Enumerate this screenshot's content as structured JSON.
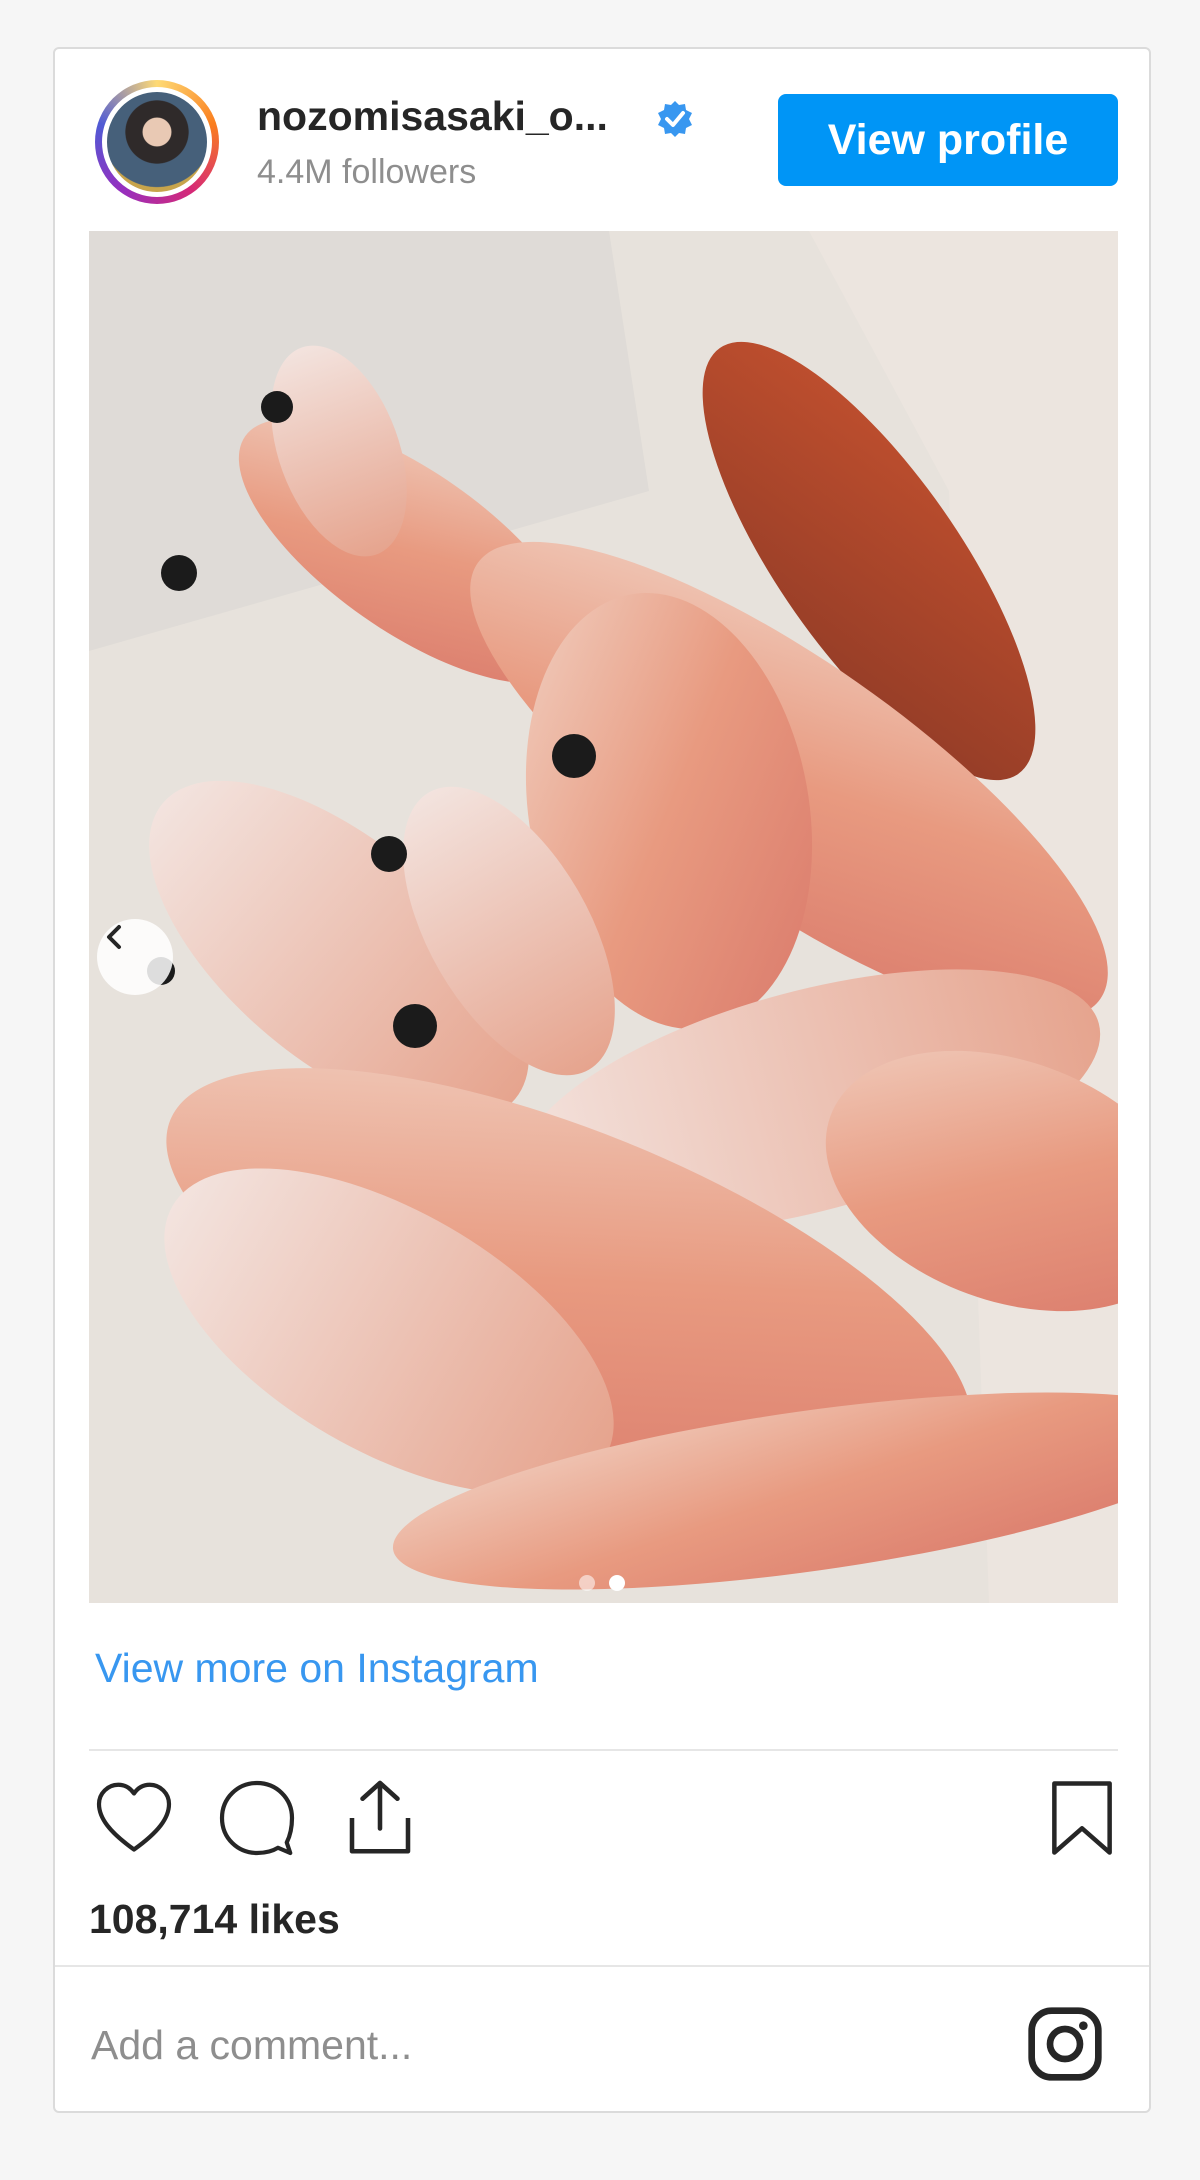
{
  "post": {
    "username": "nozomisasaki_o...",
    "followers": "4.4M followers",
    "view_profile_label": "View profile",
    "view_more_label": "View more on Instagram",
    "likes": "108,714 likes",
    "comment_placeholder": "Add a comment...",
    "carousel": {
      "total": 2,
      "active": 2
    }
  },
  "icons": {
    "verified": "verified-badge-icon",
    "like": "heart-icon",
    "comment": "comment-bubble-icon",
    "share": "share-icon",
    "save": "bookmark-icon",
    "prev": "chevron-left-icon",
    "brand": "instagram-icon"
  },
  "colors": {
    "primary": "#0095f6",
    "link": "#3897f0",
    "text": "#262626",
    "muted": "#8e8e8e",
    "border": "#dbdbdb"
  }
}
